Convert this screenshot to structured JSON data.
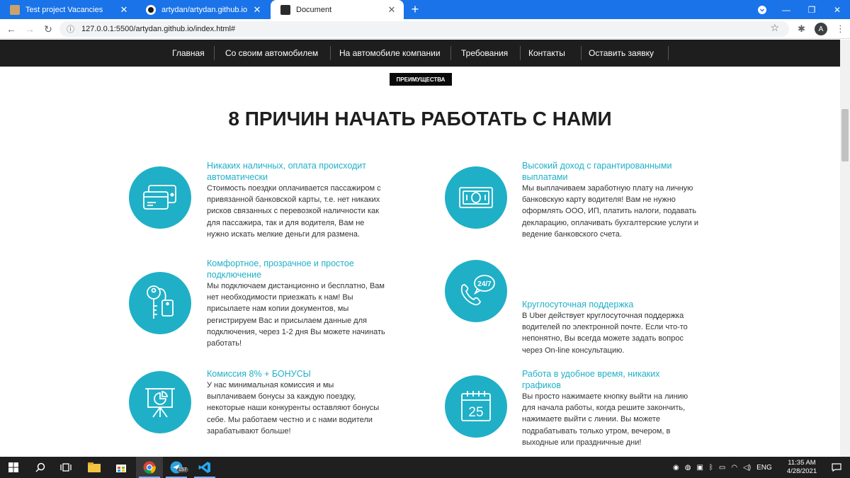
{
  "browser": {
    "tabs": [
      {
        "label": "Test project Vacancies",
        "active": false
      },
      {
        "label": "artydan/artydan.github.io",
        "active": false
      },
      {
        "label": "Document",
        "active": true
      }
    ],
    "url": "127.0.0.1:5500/artydan.github.io/index.html#",
    "profile_initial": "A"
  },
  "site": {
    "nav": [
      "Главная",
      "Со своим автомобилем",
      "На автомобиле компании",
      "Требования",
      "Контакты",
      "Оставить заявку"
    ],
    "badge": "ПРЕИМУЩЕСТВА",
    "heading": "8 ПРИЧИН НАЧАТЬ РАБОТАТЬ С НАМИ",
    "accent_color": "#1fb0c7",
    "features": [
      {
        "icon": "credit-card-icon",
        "title": [
          "Никаких наличных, оплата происходит",
          "автоматически"
        ],
        "desc": [
          "Стоимость поездки оплачивается пассажиром с",
          "привязанной банковской карты, т.е. нет никаких",
          "рисков связанных с перевозкой наличности как",
          "для пассажира, так и для водителя, Вам не",
          "нужно искать мелкие деньги для размена."
        ]
      },
      {
        "icon": "banknote-icon",
        "title": [
          "Высокий доход с гарантированными",
          "выплатами"
        ],
        "desc": [
          "Мы выплачиваем заработную плату на личную",
          "банковскую карту водителя! Вам не нужно",
          "оформлять ООО, ИП, платить налоги, подавать",
          "декларацию, оплачивать бухгалтерские услуги и",
          "ведение банковского счета."
        ]
      },
      {
        "icon": "key-tag-icon",
        "title": [
          "Комфортное, прозрачное и простое",
          "подключение"
        ],
        "desc": [
          "Мы подключаем дистанционно и бесплатно, Вам",
          "нет необходимости приезжать к нам! Вы",
          "присылаете нам копии документов, мы",
          "регистрируем Вас и присылаем данные для",
          "подключения, через 1-2 дня Вы можете начинать",
          "работать!"
        ]
      },
      {
        "icon": "phone-24-7-icon",
        "icon_text": "24/7",
        "title": [
          "Круглосуточная поддержка"
        ],
        "desc": [
          "В Uber действует круглосуточная поддержка",
          "водителей по электронной почте. Если что-то",
          "непонятно, Вы всегда можете задать вопрос",
          "через On-line консультацию."
        ]
      },
      {
        "icon": "presentation-chart-icon",
        "title": [
          "Комиссия 8% + БОНУСЫ"
        ],
        "desc": [
          "У нас минимальная комиссия и мы",
          "выплачиваем бонусы за каждую поездку,",
          "некоторые наши конкуренты оставляют бонусы",
          "себе. Мы работаем честно и с нами водители",
          "зарабатывают больше!"
        ]
      },
      {
        "icon": "calendar-icon",
        "icon_text": "25",
        "title": [
          "Работа в удобное время, никаких",
          "графиков"
        ],
        "desc": [
          "Вы просто нажимаете кнопку выйти на линию",
          "для начала работы, когда решите закончить,",
          "нажимаете выйти с линии. Вы можете",
          "подрабатывать только утром, вечером, в",
          "выходные или праздничные дни!"
        ]
      }
    ]
  },
  "taskbar": {
    "language": "ENG",
    "telegram_badge": "157",
    "time": "11:35 AM",
    "date": "4/28/2021"
  }
}
